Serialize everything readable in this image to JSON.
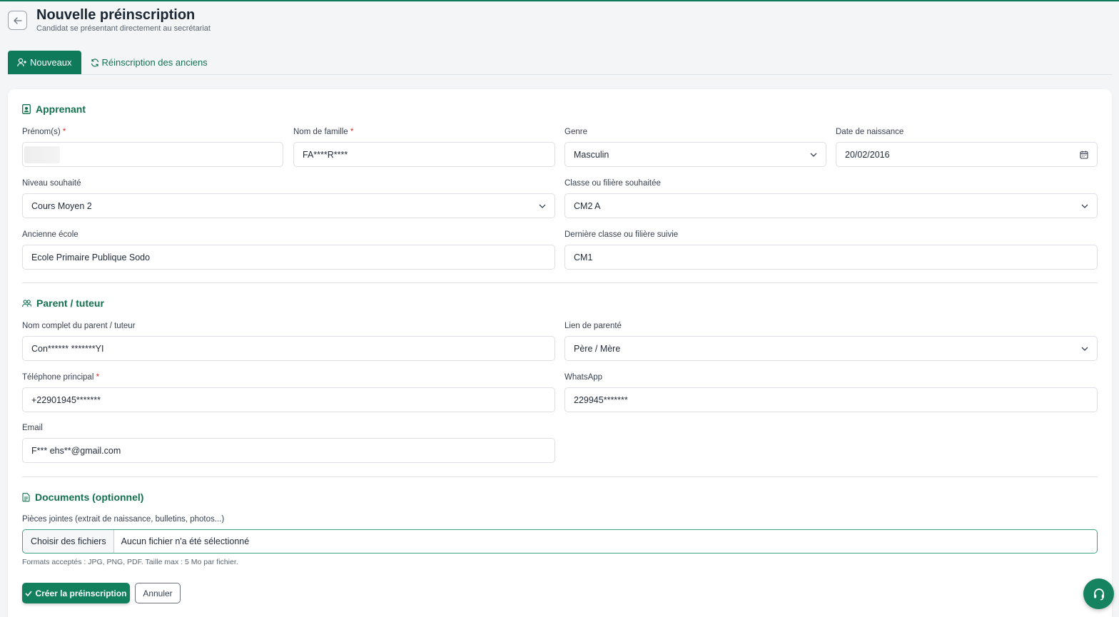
{
  "header": {
    "title": "Nouvelle préinscription",
    "subtitle": "Candidat se présentant directement au secrétariat"
  },
  "tabs": [
    {
      "label": "Nouveaux",
      "active": true
    },
    {
      "label": "Réinscription des anciens",
      "active": false
    }
  ],
  "sections": {
    "apprenant": "Apprenant",
    "parent": "Parent / tuteur",
    "documents": "Documents (optionnel)"
  },
  "apprenant": {
    "prenom_label": "Prénom(s)",
    "prenom_value": "",
    "nom_label": "Nom de famille",
    "nom_value": "FA****R****",
    "genre_label": "Genre",
    "genre_value": "Masculin",
    "naissance_label": "Date de naissance",
    "naissance_value": "20/02/2016",
    "niveau_label": "Niveau souhaité",
    "niveau_value": "Cours Moyen 2",
    "classe_label": "Classe ou filière souhaitée",
    "classe_value": "CM2 A",
    "ancienne_ecole_label": "Ancienne école",
    "ancienne_ecole_value": "Ecole Primaire Publique Sodo",
    "derniere_classe_label": "Dernière classe ou filière suivie",
    "derniere_classe_value": "CM1"
  },
  "parent": {
    "nom_label": "Nom complet du parent / tuteur",
    "nom_value": "Con****** *******YI",
    "lien_label": "Lien de parenté",
    "lien_value": "Père / Mère",
    "tel_label": "Téléphone principal",
    "tel_value": "+22901945*******",
    "whatsapp_label": "WhatsApp",
    "whatsapp_value": "229945*******",
    "email_label": "Email",
    "email_value": "F*** ehs**@gmail.com"
  },
  "documents": {
    "label": "Pièces jointes (extrait de naissance, bulletins, photos...)",
    "choose_label": "Choisir des fichiers",
    "status": "Aucun fichier n'a été sélectionné",
    "hint": "Formats acceptés : JPG, PNG, PDF. Taille max : 5 Mo par fichier."
  },
  "required_mark": "*",
  "actions": {
    "submit": "Créer la préinscription",
    "cancel": "Annuler"
  },
  "colors": {
    "accent": "#0f7a5a",
    "required": "#dc2626"
  }
}
